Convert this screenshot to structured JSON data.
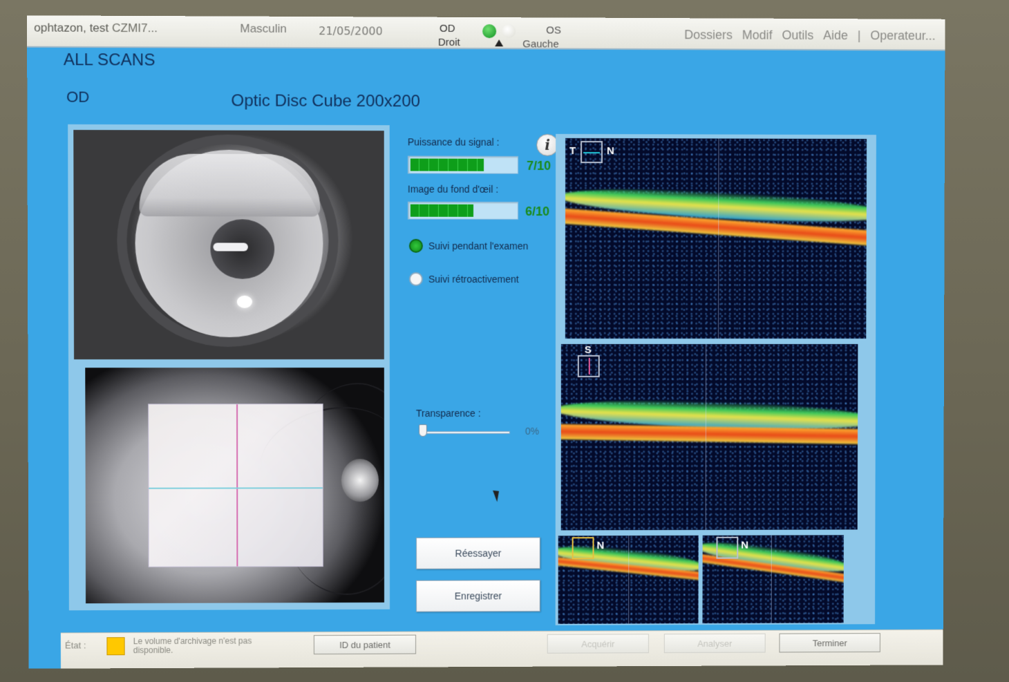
{
  "topbar": {
    "patient_name": "ophtazon, test",
    "patient_id": "CZMI7...",
    "sex": "Masculin",
    "dob": "21/05/2000",
    "eye_od": "OD",
    "eye_droit": "Droit",
    "eye_os": "OS",
    "eye_gauche": "Gauche",
    "menu": [
      "Dossiers",
      "Modif",
      "Outils",
      "Aide",
      "|",
      "Operateur..."
    ]
  },
  "header": {
    "mode": "ALL SCANS",
    "eye": "OD",
    "scan_title": "Optic Disc Cube 200x200"
  },
  "quality": {
    "signal_label": "Puissance du signal :",
    "signal_value": "7/10",
    "signal_fraction": 0.7,
    "fundus_label": "Image du fond d'œil :",
    "fundus_value": "6/10",
    "fundus_fraction": 0.6,
    "info_glyph": "i"
  },
  "tracking": {
    "during_label": "Suivi pendant l'examen",
    "retro_label": "Suivi rétroactivement",
    "selected": "during"
  },
  "transparency": {
    "label": "Transparence :",
    "value": "0%",
    "fraction": 0
  },
  "actions": {
    "retry": "Réessayer",
    "save": "Enregistrer"
  },
  "oct": {
    "scan1_left": "T",
    "scan1_right": "N",
    "scan2_top": "S",
    "scan3_right": "N",
    "scan4_right": "N"
  },
  "status": {
    "state_label": "État :",
    "message": "Le volume d'archivage n'est pas disponible.",
    "patient_id_button": "ID du patient",
    "acquire_button": "Acquérir",
    "analyze_button": "Analyser",
    "finish_button": "Terminer",
    "warn_color": "#ffc800"
  }
}
